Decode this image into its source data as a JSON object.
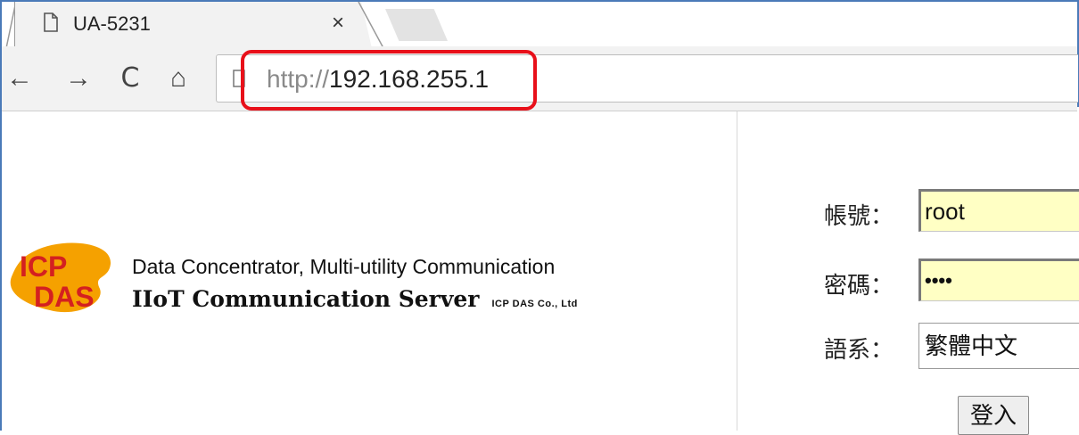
{
  "tab": {
    "title": "UA-5231",
    "close": "×"
  },
  "nav": {
    "back": "←",
    "forward": "→",
    "reload": "C",
    "home": "⌂"
  },
  "address": {
    "scheme": "http://",
    "host": "192.168.255.1"
  },
  "page": {
    "tagline_line1": "Data Concentrator, Multi-utility Communication",
    "tagline_line2": "IIoT Communication Server",
    "company": "ICP DAS Co., Ltd",
    "logo_text": [
      "ICP",
      "DAS"
    ]
  },
  "login": {
    "account_label": "帳號：",
    "account_value": "root",
    "password_label": "密碼：",
    "password_value": "••••",
    "language_label": "語系：",
    "language_value": "繁體中文",
    "submit_label": "登入"
  },
  "colors": {
    "highlight": "#e8101a",
    "frame": "#4a7ab8",
    "input_bg": "#ffffc4",
    "logo_orange": "#f5a100",
    "logo_red": "#d42020"
  }
}
